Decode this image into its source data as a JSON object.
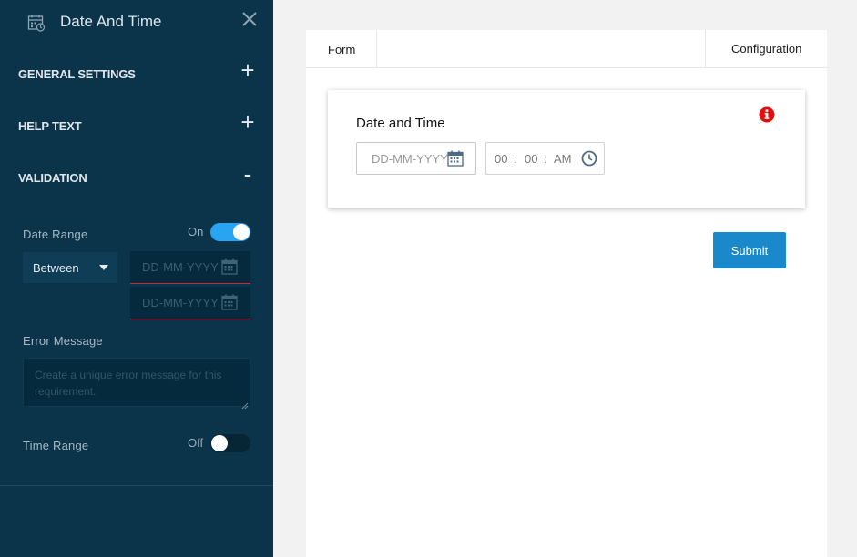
{
  "sidebar": {
    "title": "Date And Time",
    "sections": [
      {
        "label": "GENERAL SETTINGS",
        "toggle": "+"
      },
      {
        "label": "HELP TEXT",
        "toggle": "+"
      },
      {
        "label": "VALIDATION",
        "toggle": "-"
      }
    ],
    "validation": {
      "date_range": {
        "label": "Date Range",
        "state_text": "On",
        "enabled": true,
        "operator": "Between",
        "start_placeholder": "DD-MM-YYYY",
        "end_placeholder": "DD-MM-YYYY"
      },
      "error_message": {
        "label": "Error Message",
        "placeholder": "Create a unique error message for this requirement."
      },
      "time_range": {
        "label": "Time Range",
        "state_text": "Off",
        "enabled": false
      }
    }
  },
  "main": {
    "tabs": [
      {
        "label": "Form"
      },
      {
        "label": "Configuration"
      }
    ],
    "field": {
      "title": "Date and Time",
      "date_placeholder": "DD-MM-YYYY",
      "time": {
        "hour": "00",
        "sep1": ":",
        "minute": "00",
        "sep2": ":",
        "meridiem": "AM"
      }
    },
    "submit_label": "Submit"
  },
  "colors": {
    "sidebar_bg": "#0b3349",
    "toggle_on": "#27a4f2",
    "error_line": "#d0263b",
    "submit_bg": "#1989cc",
    "info_icon": "#e01010"
  }
}
